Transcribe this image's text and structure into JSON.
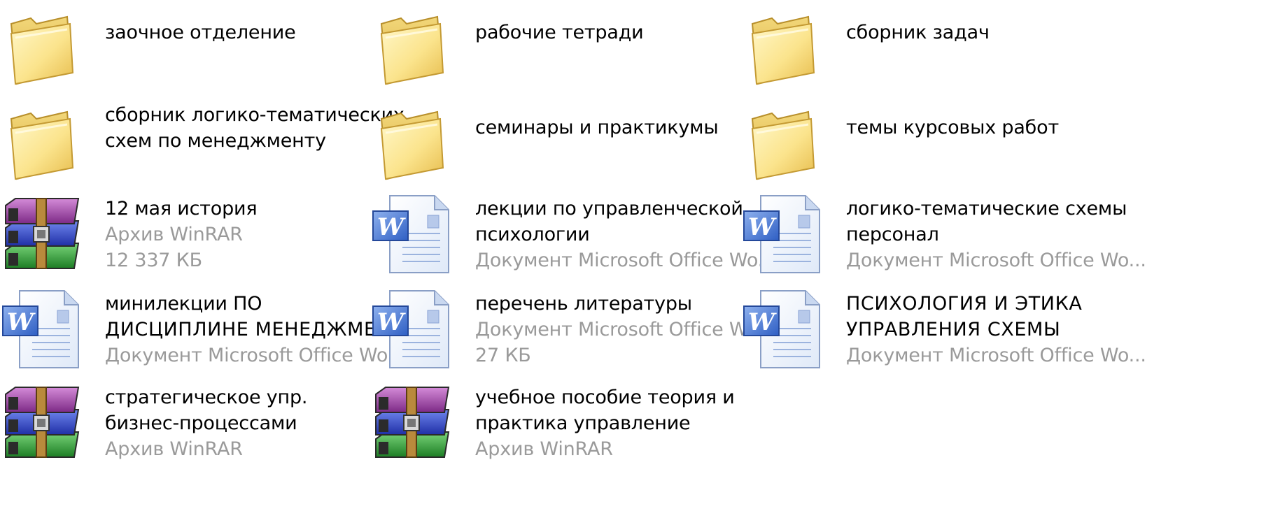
{
  "window": {
    "background": "#ffffff",
    "name_color": "#000000",
    "meta_color": "#9a9a9a"
  },
  "files": [
    {
      "kind": "folder",
      "icon": "folder-icon",
      "name": [
        "заочное отделение"
      ],
      "meta": []
    },
    {
      "kind": "folder",
      "icon": "folder-icon",
      "name": [
        "рабочие тетради"
      ],
      "meta": []
    },
    {
      "kind": "folder",
      "icon": "folder-icon",
      "name": [
        "сборник задач"
      ],
      "meta": []
    },
    {
      "kind": "folder",
      "icon": "folder-icon",
      "name": [
        "сборник логико-тематических",
        "схем по менеджменту"
      ],
      "meta": []
    },
    {
      "kind": "folder",
      "icon": "folder-icon",
      "name": [
        "семинары и практикумы"
      ],
      "meta": []
    },
    {
      "kind": "folder",
      "icon": "folder-icon",
      "name": [
        "темы курсовых работ"
      ],
      "meta": []
    },
    {
      "kind": "rar",
      "icon": "winrar-archive-icon",
      "name": [
        "12 мая история"
      ],
      "meta": [
        "Архив WinRAR",
        "12 337 КБ"
      ]
    },
    {
      "kind": "word",
      "icon": "word-document-icon",
      "name": [
        "лекции по управленческой",
        "психологии"
      ],
      "meta": [
        "Документ Microsoft Office Wo..."
      ]
    },
    {
      "kind": "word",
      "icon": "word-document-icon",
      "name": [
        "логико-тематические схемы",
        "персонал"
      ],
      "meta": [
        "Документ Microsoft Office Wo..."
      ]
    },
    {
      "kind": "word",
      "icon": "word-document-icon",
      "name": [
        "минилекции ПО",
        "ДИСЦИПЛИНЕ МЕНЕДЖМЕ..."
      ],
      "meta": [
        "Документ Microsoft Office Wo..."
      ]
    },
    {
      "kind": "word",
      "icon": "word-document-icon",
      "name": [
        "перечень литературы"
      ],
      "meta": [
        "Документ Microsoft Office Wo...",
        "27 КБ"
      ]
    },
    {
      "kind": "word",
      "icon": "word-document-icon",
      "name": [
        "ПСИХОЛОГИЯ И ЭТИКА",
        "УПРАВЛЕНИЯ СХЕМЫ"
      ],
      "meta": [
        "Документ Microsoft Office Wo..."
      ]
    },
    {
      "kind": "rar",
      "icon": "winrar-archive-icon",
      "name": [
        "стратегическое упр.",
        "бизнес-процессами"
      ],
      "meta": [
        "Архив WinRAR"
      ]
    },
    {
      "kind": "rar",
      "icon": "winrar-archive-icon",
      "name": [
        "учебное пособие теория и",
        "практика управление"
      ],
      "meta": [
        "Архив WinRAR"
      ]
    }
  ]
}
